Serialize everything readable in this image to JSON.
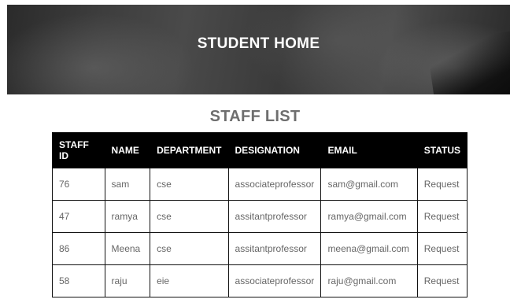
{
  "header": {
    "title": "STUDENT HOME"
  },
  "staff_list": {
    "title": "STAFF LIST",
    "columns": [
      "STAFF ID",
      "NAME",
      "DEPARTMENT",
      "DESIGNATION",
      "EMAIL",
      "STATUS"
    ],
    "rows": [
      {
        "id": "76",
        "name": "sam",
        "department": "cse",
        "designation": "associateprofessor",
        "email": "sam@gmail.com",
        "status": "Request"
      },
      {
        "id": "47",
        "name": "ramya",
        "department": "cse",
        "designation": "assitantprofessor",
        "email": "ramya@gmail.com",
        "status": "Request"
      },
      {
        "id": "86",
        "name": "Meena",
        "department": "cse",
        "designation": "assitantprofessor",
        "email": "meena@gmail.com",
        "status": "Request"
      },
      {
        "id": "58",
        "name": "raju",
        "department": "eie",
        "designation": "associateprofessor",
        "email": "raju@gmail.com",
        "status": "Request"
      }
    ]
  }
}
